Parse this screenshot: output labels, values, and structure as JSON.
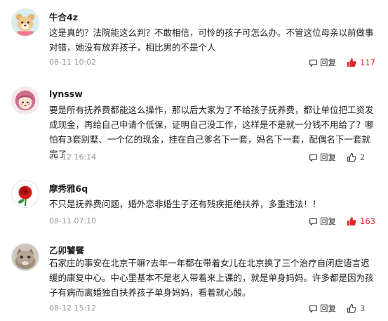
{
  "ui": {
    "reply_label": "回复"
  },
  "comments": [
    {
      "username": "牛合4z",
      "avatar_icon": "bear-avatar-icon",
      "text": "这是真的？法院能这么判？不敢相信，可怜的孩子可怎么办。不管这位母亲以前做事对错，她没有放弃孩子，相比男的不是个人",
      "time": "08-11 10:02",
      "likes": "117",
      "like_color": "#e0262e"
    },
    {
      "username": "lynssw",
      "avatar_icon": "cartoon-girl-avatar-icon",
      "text": "要是所有抚养费都能这么操作，那以后大家为了不给孩子抚养费，都让单位把工资发成现金，再给自己申请个低保，证明自己没工作，这样是不是就一分钱不用给了？哪怕有3套别墅、一个亿的现金，挂在自己爹名下一套，妈名下一套，配偶名下一套就完了",
      "time": "08-12 16:14",
      "likes": "2",
      "like_color": "#555555"
    },
    {
      "username": "摩秀雅6q",
      "avatar_icon": "red-rose-avatar-icon",
      "text": "不只是抚养费问题，婚外恋非婚生子还有残疾拒绝扶养，多重违法！！",
      "time": "08-11 07:10",
      "likes": "163",
      "like_color": "#e0262e"
    },
    {
      "username": "乙卯饕餮",
      "avatar_icon": "cat-photo-avatar-icon",
      "text": "石家庄的事安在北京干嘛?去年一年都在带着女儿在北京换了三个治疗自闭症语言迟缓的康复中心。中心里基本不是老人带着来上课的，就是单身妈妈。许多都是因为孩子有病而离婚独自扶养孩子单身妈妈，看着就心酸。",
      "time": "08-12 15:12",
      "likes": "3",
      "like_color": "#555555"
    }
  ]
}
